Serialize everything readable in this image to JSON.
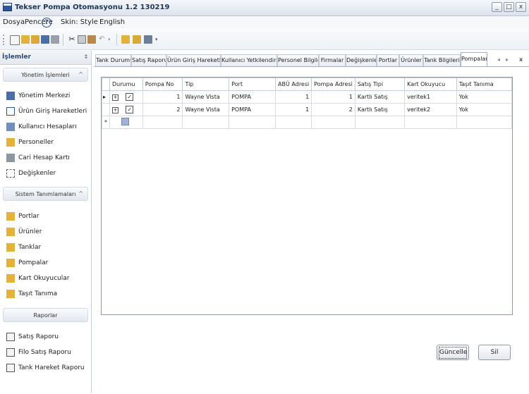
{
  "window": {
    "title": "Tekser Pompa Otomasyonu 1.2 130219",
    "controls": [
      "_",
      "□",
      "x"
    ]
  },
  "menu": {
    "dosya": "Dosya",
    "pencere": "Pencere",
    "help": "?",
    "skin": "Skin: Style",
    "english": "English"
  },
  "sidebar": {
    "title": "İşlemler",
    "pin": "‡",
    "groups": [
      {
        "title": "Yönetim İşlemleri",
        "items": [
          "Yönetim Merkezi",
          "Ürün Giriş Hareketleri",
          "Kullanıcı Hesapları",
          "Personeller",
          "Cari Hesap Kartı",
          "Değişkenler"
        ]
      },
      {
        "title": "Sistem Tanımlamaları",
        "items": [
          "Portlar",
          "Ürünler",
          "Tanklar",
          "Pompalar",
          "Kart Okuyucular",
          "Taşıt Tanıma"
        ]
      },
      {
        "title": "Raporlar",
        "items": [
          "Satış Raporu",
          "Filo Satış Raporu",
          "Tank Hareket Raporu"
        ]
      }
    ]
  },
  "tabs": [
    "Tank Durumu",
    "Satış Raporu",
    "Ürün Giriş Hareketleri",
    "Kullanıcı Yetkilendirme",
    "Personel Bilgileri",
    "Firmalar",
    "Değişkenler",
    "Portlar",
    "Ürünler",
    "Tank Bilgileri",
    "Pompalar"
  ],
  "active_tab": "Pompalar",
  "tab_nav": {
    "prev": "◂",
    "next": "▸",
    "close": "x"
  },
  "grid": {
    "columns": [
      "Durumu",
      "Pompa No",
      "Tip",
      "Port",
      "ABÜ Adresi",
      "Pompa Adresi",
      "Satış Tipi",
      "Kart Okuyucu",
      "Taşıt Tanıma"
    ],
    "rows": [
      {
        "indicator": "▸",
        "expander": "+",
        "durumu": "✓",
        "pompa_no": "1",
        "tip": "Wayne Vista",
        "port": "POMPA",
        "abu": "1",
        "pompa_adresi": "1",
        "satis_tipi": "Kartlı Satış",
        "kart_okuyucu": "veritek1",
        "tasit": "Yok"
      },
      {
        "indicator": "",
        "expander": "+",
        "durumu": "✓",
        "pompa_no": "2",
        "tip": "Wayne Vista",
        "port": "POMPA",
        "abu": "1",
        "pompa_adresi": "2",
        "satis_tipi": "Kartlı Satış",
        "kart_okuyucu": "veritek2",
        "tasit": "Yok"
      }
    ],
    "new_row_marker": "*"
  },
  "buttons": {
    "update": "Güncelle",
    "delete": "Sil"
  },
  "colors": {
    "accent": "#2b5797",
    "header_text": "#2b4a73",
    "folder_icon": "#e3b23c"
  }
}
